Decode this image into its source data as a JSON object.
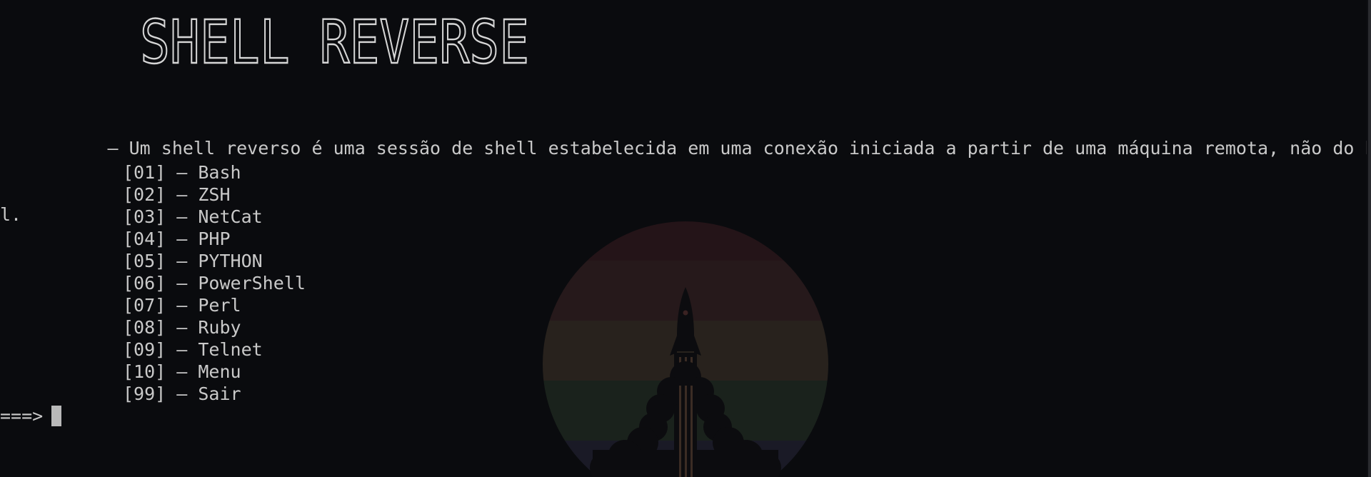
{
  "banner": {
    "title": "SHELL REVERSE"
  },
  "description": {
    "line1": "          — Um shell reverso é uma sessão de shell estabelecida em uma conexão iniciada a partir de uma máquina remota, não do host loca",
    "line2": "l."
  },
  "menu": {
    "items": [
      {
        "number": "[01]",
        "label": "Bash"
      },
      {
        "number": "[02]",
        "label": "ZSH"
      },
      {
        "number": "[03]",
        "label": "NetCat"
      },
      {
        "number": "[04]",
        "label": "PHP"
      },
      {
        "number": "[05]",
        "label": "PYTHON"
      },
      {
        "number": "[06]",
        "label": "PowerShell"
      },
      {
        "number": "[07]",
        "label": "Perl"
      },
      {
        "number": "[08]",
        "label": "Ruby"
      },
      {
        "number": "[09]",
        "label": "Telnet"
      },
      {
        "number": "[10]",
        "label": "Menu"
      },
      {
        "number": "[99]",
        "label": "Sair"
      }
    ],
    "separator": " — "
  },
  "prompt": {
    "text": "===>"
  },
  "colors": {
    "background": "#0a0b0e",
    "text": "#c9c9c9",
    "cursor": "#b9b9b9"
  },
  "wallpaper": {
    "icon": "rocket-icon"
  }
}
